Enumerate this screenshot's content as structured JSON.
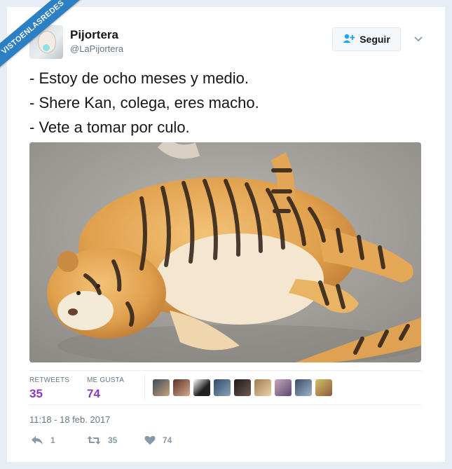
{
  "watermark": "VISTOENLASREDES",
  "author": {
    "name": "Pijortera",
    "handle": "@LaPijortera"
  },
  "follow_button": {
    "label": "Seguir",
    "icon": "add-user-icon"
  },
  "menu_icon": "chevron-down-icon",
  "tweet": {
    "lines": [
      "- Estoy de ocho meses y medio.",
      "- Shere Kan, colega, eres macho.",
      "- Vete a tomar por culo."
    ]
  },
  "stats": {
    "retweets_label": "RETWEETS",
    "retweets_value": "35",
    "likes_label": "ME GUSTA",
    "likes_value": "74"
  },
  "timestamp": "11:18 - 18 feb. 2017",
  "actions": {
    "reply_count": "1",
    "retweet_count": "35",
    "like_count": "74"
  },
  "colors": {
    "accent": "#1da1f2",
    "count": "#8a3ab9",
    "watermark": "#2b7fc3"
  }
}
